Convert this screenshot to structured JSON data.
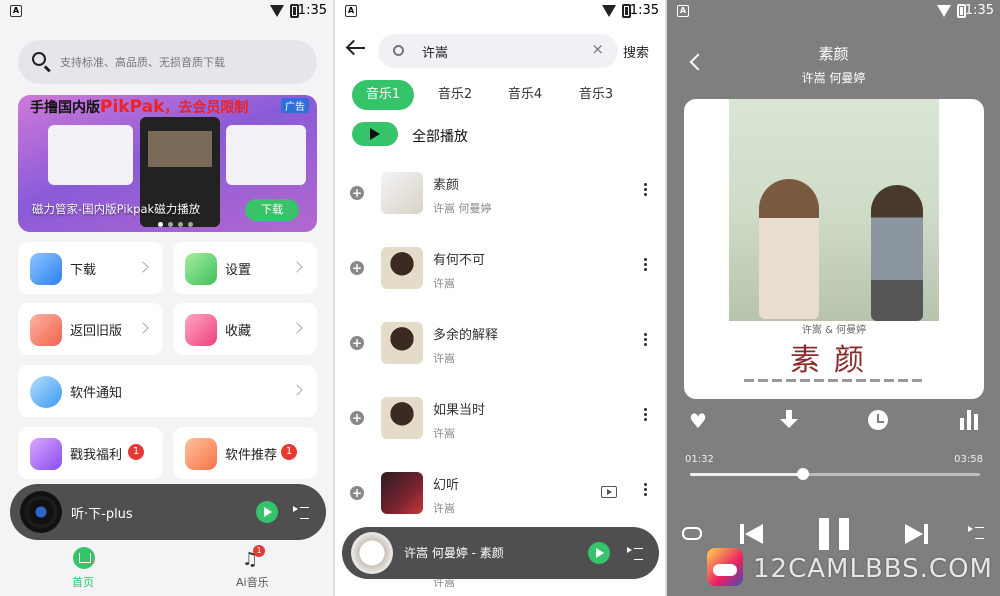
{
  "status_bar": {
    "time": "1:35",
    "badge": "A"
  },
  "home": {
    "search_placeholder": "支持标准、高品质、无损音质下载",
    "banner": {
      "title_part1": "手撸国内版",
      "title_brand": "PikPak",
      "title_part2": "，去会员限制",
      "ad_label": "广告",
      "caption": "磁力管家-国内版Pikpak磁力播放",
      "download_label": "下载"
    },
    "cards": {
      "download": "下载",
      "settings": "设置",
      "old_version": "返回旧版",
      "favorites": "收藏",
      "notice": "软件通知",
      "welfare": "戳我福利",
      "welfare_badge": "1",
      "recommend": "软件推荐",
      "recommend_badge": "1"
    },
    "mini_player": {
      "title": "听·下-plus"
    },
    "bottom_nav": {
      "home": "首页",
      "ai_music": "Ai音乐",
      "ai_badge": "1"
    }
  },
  "search": {
    "query": "许嵩",
    "clear_icon": "×",
    "search_label": "搜索",
    "tabs": [
      "音乐1",
      "音乐2",
      "音乐4",
      "音乐3"
    ],
    "play_all": "全部播放",
    "songs": [
      {
        "title": "素颜",
        "artist": "许嵩 何曼婷",
        "mv": false
      },
      {
        "title": "有何不可",
        "artist": "许嵩",
        "mv": false
      },
      {
        "title": "多余的解释",
        "artist": "许嵩",
        "mv": false
      },
      {
        "title": "如果当时",
        "artist": "许嵩",
        "mv": false
      },
      {
        "title": "幻听",
        "artist": "许嵩",
        "mv": true
      }
    ],
    "peek_artist": "许嵩",
    "mini_player": {
      "title": "许嵩 何曼婷 - 素颜"
    }
  },
  "player": {
    "title": "素颜",
    "artist": "许嵩 何曼婷",
    "album_artists": "许嵩 & 何曼婷",
    "album_title": "素颜",
    "current_time": "01:32",
    "total_time": "03:58",
    "progress": 0.39,
    "watermark": "12CAMLBBS.COM"
  },
  "colors": {
    "accent": "#36c46a",
    "badge": "#e53935",
    "player_bg": "#7f7f7f"
  }
}
